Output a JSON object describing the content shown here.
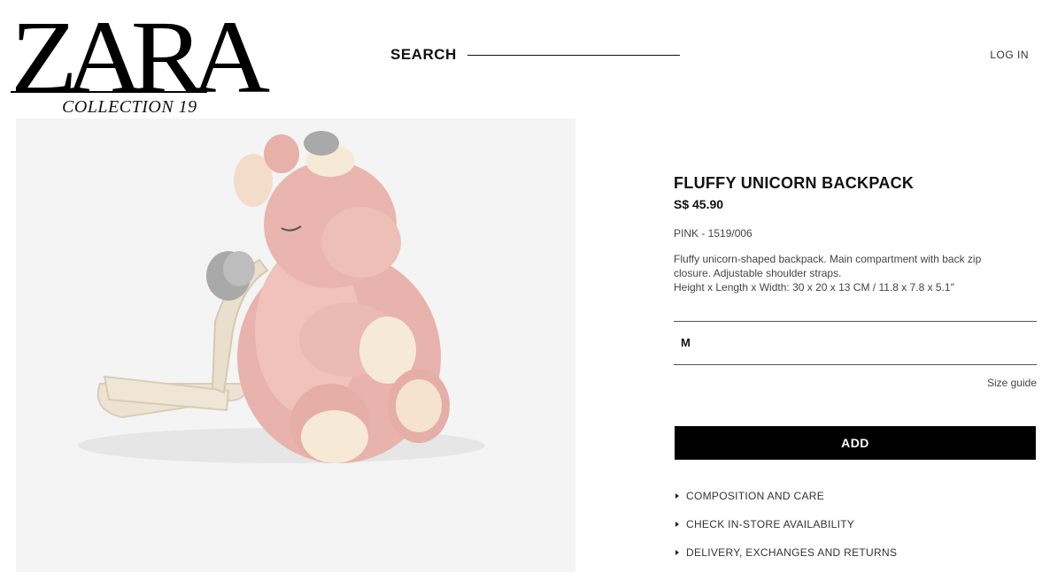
{
  "header": {
    "brand": "ZARA",
    "collection": "COLLECTION 19",
    "search_label": "SEARCH",
    "login_label": "LOG IN"
  },
  "product": {
    "title": "FLUFFY UNICORN BACKPACK",
    "price": "S$ 45.90",
    "color_ref": "PINK - 1519/006",
    "description_1": "Fluffy unicorn-shaped backpack. Main compartment with back zip closure. Adjustable shoulder straps.",
    "description_2": "Height x Length x Width: 30 x 20 x 13 CM / 11.8 x 7.8 x 5.1″",
    "size": "M",
    "size_guide": "Size guide",
    "add_label": "ADD"
  },
  "accordions": [
    {
      "label": "COMPOSITION AND CARE"
    },
    {
      "label": "CHECK IN-STORE AVAILABILITY"
    },
    {
      "label": "DELIVERY, EXCHANGES AND RETURNS"
    }
  ],
  "colors": {
    "image_background": "#f4f4f4",
    "button": "#000000",
    "plush_pink": "#e8b3ac",
    "plush_cream": "#f6ead6",
    "wing_grey": "#a9a9a9"
  }
}
